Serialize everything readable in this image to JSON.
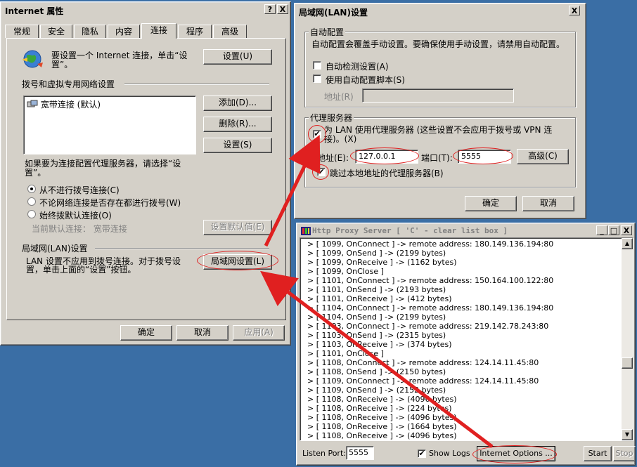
{
  "ie_props": {
    "title": "Internet 属性",
    "title_help": "?",
    "title_close": "X",
    "tabs": [
      "常规",
      "安全",
      "隐私",
      "内容",
      "连接",
      "程序",
      "高级"
    ],
    "intro_text": "要设置一个 Internet 连接，单击“设置”。",
    "setup_button": "设置(U)",
    "dialup_section": "拨号和虚拟专用网络设置",
    "dialup_items": [
      "宽带连接 (默认)"
    ],
    "add_button": "添加(D)...",
    "remove_button": "删除(R)...",
    "settings_button": "设置(S)",
    "proxy_hint": "如果要为连接配置代理服务器，请选择“设置”。",
    "radio_never": "从不进行拨号连接(C)",
    "radio_whenever": "不论网络连接是否存在都进行拨号(W)",
    "radio_always": "始终拨默认连接(O)",
    "current_default_label": "当前默认连接：",
    "current_default_value": "宽带连接",
    "set_default_button": "设置默认值(E)",
    "lan_section": "局域网(LAN)设置",
    "lan_text": "LAN 设置不应用到拨号连接。对于拨号设置，单击上面的“设置”按钮。",
    "lan_button": "局域网设置(L)",
    "ok_button": "确定",
    "cancel_button": "取消",
    "apply_button": "应用(A)"
  },
  "lan": {
    "title": "局域网(LAN)设置",
    "title_close": "X",
    "auto_group": "自动配置",
    "auto_desc": "自动配置会覆盖手动设置。要确保使用手动设置，请禁用自动配置。",
    "auto_detect": "自动检测设置(A)",
    "auto_script": "使用自动配置脚本(S)",
    "address_label": "地址(R)",
    "proxy_group": "代理服务器",
    "use_proxy": "为 LAN 使用代理服务器 (这些设置不会应用于拨号或 VPN 连接)。(X)",
    "proxy_address_label": "地址(E):",
    "proxy_address_value": "127.0.0.1",
    "port_label": "端口(T):",
    "port_value": "5555",
    "advanced_button": "高级(C)",
    "bypass_local": "跳过本地地址的代理服务器(B)",
    "check_mark": "✔",
    "ok_button": "确定",
    "cancel_button": "取消"
  },
  "proxy": {
    "title": "Http Proxy Server [ 'C' - clear list box ]",
    "title_min": "_",
    "title_max": "□",
    "title_close": "X",
    "log": [
      "> [ 1099, OnConnect ] -> remote address: 180.149.136.194:80",
      "> [ 1099, OnSend ] -> (2199 bytes)",
      "> [ 1099, OnReceive ] -> (1162 bytes)",
      "> [ 1099, OnClose ]",
      "> [ 1101, OnConnect ] -> remote address: 150.164.100.122:80",
      "> [ 1101, OnSend ] -> (2193 bytes)",
      "> [ 1101, OnReceive ] -> (412 bytes)",
      "> [ 1104, OnConnect ] -> remote address: 180.149.136.194:80",
      "> [ 1104, OnSend ] -> (2199 bytes)",
      "> [ 1103, OnConnect ] -> remote address: 219.142.78.243:80",
      "> [ 1103, OnSend ] -> (2315 bytes)",
      "> [ 1103, OnReceive ] -> (374 bytes)",
      "> [ 1101, OnClose ]",
      "> [ 1108, OnConnect ] -> remote address: 124.14.11.45:80",
      "> [ 1108, OnSend ] -> (2150 bytes)",
      "> [ 1109, OnConnect ] -> remote address: 124.14.11.45:80",
      "> [ 1109, OnSend ] -> (2152 bytes)",
      "> [ 1108, OnReceive ] -> (4096 bytes)",
      "> [ 1108, OnReceive ] -> (224 bytes)",
      "> [ 1108, OnReceive ] -> (4096 bytes)",
      "> [ 1108, OnReceive ] -> (1664 bytes)",
      "> [ 1108, OnReceive ] -> (4096 bytes)"
    ],
    "listen_port_label": "Listen Port:",
    "listen_port_value": "5555",
    "show_logs_label": "Show Logs",
    "internet_options_button": "Internet Options ...",
    "start_button": "Start",
    "stop_button": "Stop",
    "scroll_up": "▲",
    "scroll_down": "▼"
  },
  "colors": {
    "desktop": "#3a6ea5",
    "window_face": "#d4d0c8",
    "annotation_red": "#e02020"
  }
}
